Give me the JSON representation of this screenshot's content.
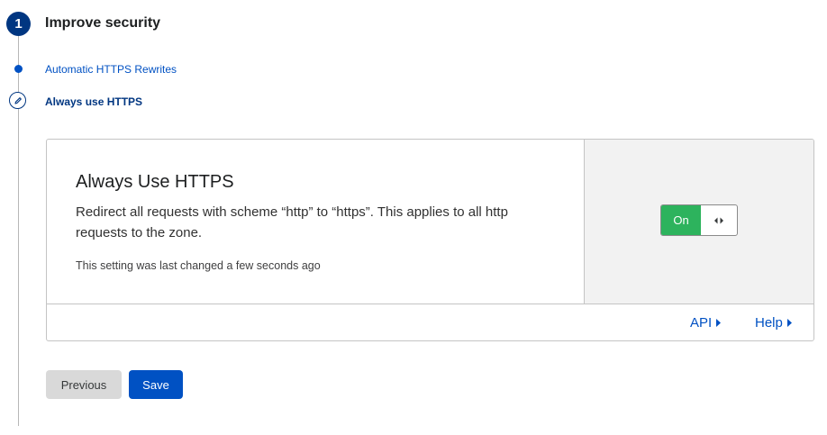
{
  "step": {
    "number": "1",
    "title": "Improve security",
    "substeps": [
      {
        "label": "Automatic HTTPS Rewrites"
      },
      {
        "label": "Always use HTTPS"
      }
    ]
  },
  "card": {
    "title": "Always Use HTTPS",
    "description": "Redirect all requests with scheme “http” to “https”. This applies to all http requests to the zone.",
    "meta": "This setting was last changed a few seconds ago",
    "toggle": {
      "label": "On",
      "state": "on",
      "color": "#2db35d"
    },
    "links": {
      "api": "API",
      "help": "Help"
    }
  },
  "buttons": {
    "previous": "Previous",
    "save": "Save"
  },
  "colors": {
    "primary": "#0051c3",
    "step_navy": "#003681",
    "toggle_on": "#2db35d"
  },
  "icons": {
    "edit": "pencil-icon",
    "toggle_handle": "drag-handle-icon",
    "link_arrow": "caret-right-icon"
  }
}
